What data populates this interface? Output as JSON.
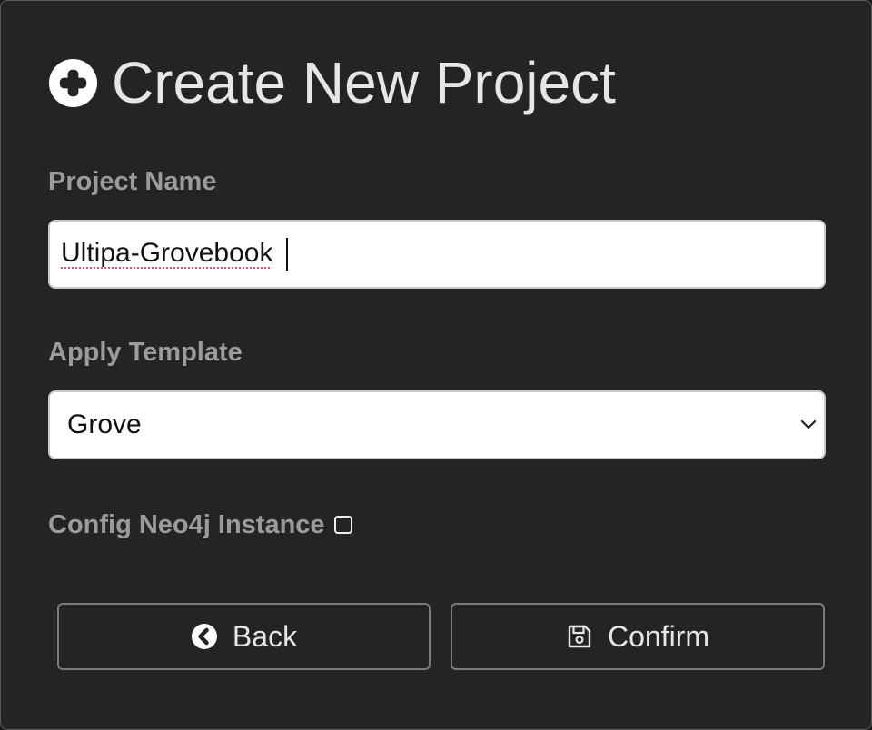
{
  "dialog": {
    "title": "Create New Project",
    "title_icon": "plus-circle-icon"
  },
  "project_name": {
    "label": "Project Name",
    "value": "Ultipa-Grovebook"
  },
  "template": {
    "label": "Apply Template",
    "selected": "Grove",
    "icon": "chevron-down-icon"
  },
  "neo4j": {
    "label": "Config Neo4j Instance",
    "checked": false
  },
  "buttons": {
    "back_label": "Back",
    "back_icon": "arrow-left-circle-icon",
    "confirm_label": "Confirm",
    "confirm_icon": "save-icon"
  },
  "colors": {
    "background": "#242424",
    "label": "#9b9b9b",
    "title": "#e6e6e6",
    "input_bg": "#ffffff",
    "button_border": "#7a7a7a"
  }
}
